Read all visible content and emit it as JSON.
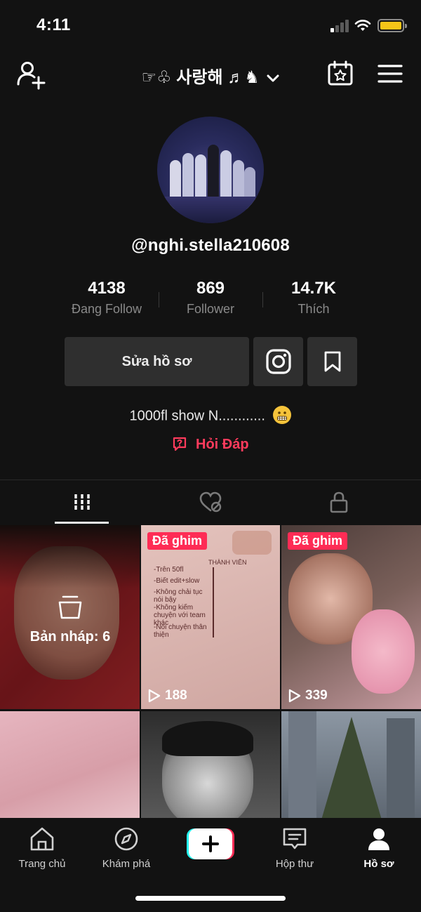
{
  "status_bar": {
    "time": "4:11"
  },
  "header": {
    "title": "☞♧ 사랑해 ♬♞",
    "icons": [
      "add-user-icon",
      "chevron-down-icon",
      "calendar-star-icon",
      "hamburger-menu-icon"
    ]
  },
  "profile": {
    "username": "@nghi.stella210608",
    "stats": [
      {
        "value": "4138",
        "label": "Đang Follow"
      },
      {
        "value": "869",
        "label": "Follower"
      },
      {
        "value": "14.7K",
        "label": "Thích"
      }
    ],
    "edit_label": "Sửa hồ sơ",
    "bio": "1000fl show N............",
    "qa_label": "Hỏi Đáp"
  },
  "tabs": [
    {
      "icon": "grid-icon",
      "active": true
    },
    {
      "icon": "liked-heart-icon",
      "active": false
    },
    {
      "icon": "lock-icon",
      "active": false
    }
  ],
  "grid": {
    "draft_label": "Bản nháp: 6",
    "pinned_label": "Đã ghim",
    "videos": [
      {
        "views": "188",
        "pinned": true
      },
      {
        "views": "339",
        "pinned": true
      }
    ],
    "note_card": {
      "header": "THÀNH VIÊN",
      "lines": [
        "-Trên 50fl",
        "-Biết edit+slow",
        "-Không chải tục nói bậy",
        "-Không kiếm chuyện với team khác",
        "-Nói chuyện thân thiện"
      ]
    }
  },
  "bottom_nav": [
    {
      "label": "Trang chủ",
      "icon": "home-icon"
    },
    {
      "label": "Khám phá",
      "icon": "compass-icon"
    },
    {
      "label": "",
      "icon": "plus-icon"
    },
    {
      "label": "Hộp thư",
      "icon": "inbox-icon"
    },
    {
      "label": "Hồ sơ",
      "icon": "profile-icon",
      "active": true
    }
  ],
  "colors": {
    "accent": "#fe2c55",
    "background": "#121212",
    "button": "#2f2f2f"
  }
}
